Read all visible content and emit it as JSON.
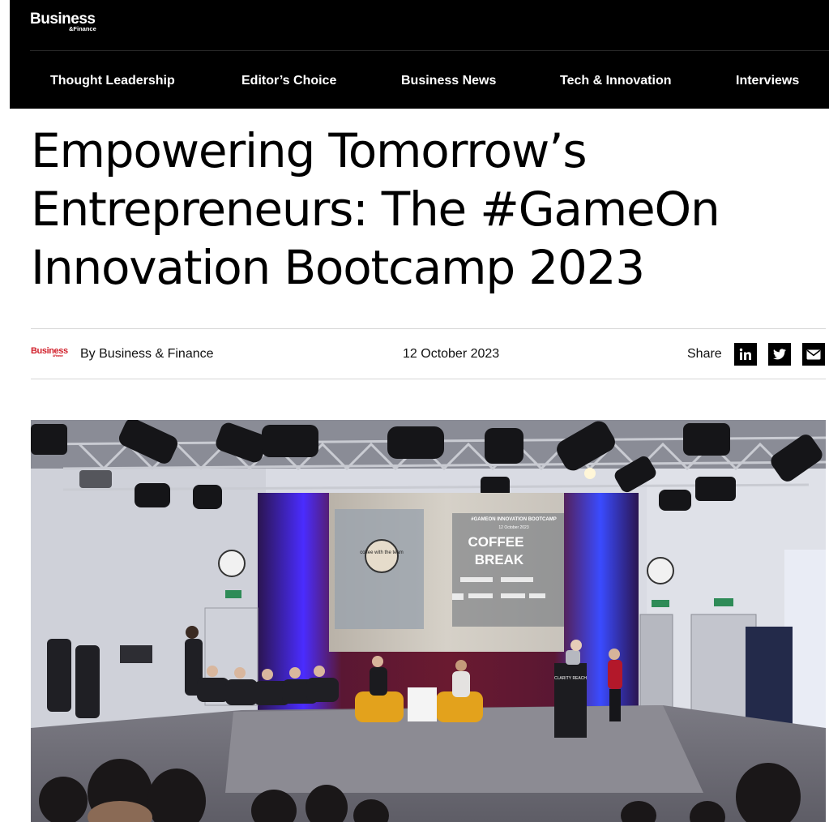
{
  "brand": {
    "name": "Business",
    "sub": "&Finance"
  },
  "nav": {
    "items": [
      {
        "label": "Thought Leadership"
      },
      {
        "label": "Editor’s Choice"
      },
      {
        "label": "Business News"
      },
      {
        "label": "Tech & Innovation"
      },
      {
        "label": "Interviews"
      }
    ]
  },
  "article": {
    "title_lines": [
      "Empowering Tomorrow’s",
      "Entrepreneurs: The #GameOn",
      "Innovation Bootcamp 2023"
    ],
    "author": "By Business & Finance",
    "date": "12 October 2023",
    "share_label": "Share",
    "share_icons": [
      "linkedin-icon",
      "twitter-icon",
      "email-icon"
    ],
    "author_logo": {
      "name": "Business",
      "sub": "&Finance"
    }
  },
  "hero": {
    "screen_tag": "#GAMEON INNOVATION BOOTCAMP",
    "screen_sub": "12 October 2023",
    "screen_line1": "COFFEE",
    "screen_line2": "BREAK",
    "screen_badge": "coffee with the team",
    "lectern_label": "CLARITY REACH"
  },
  "colors": {
    "topbar": "#000000",
    "brand_red": "#d11f2a",
    "curtain": "#5a1a2e",
    "stage_blue": "#2a50ff"
  }
}
